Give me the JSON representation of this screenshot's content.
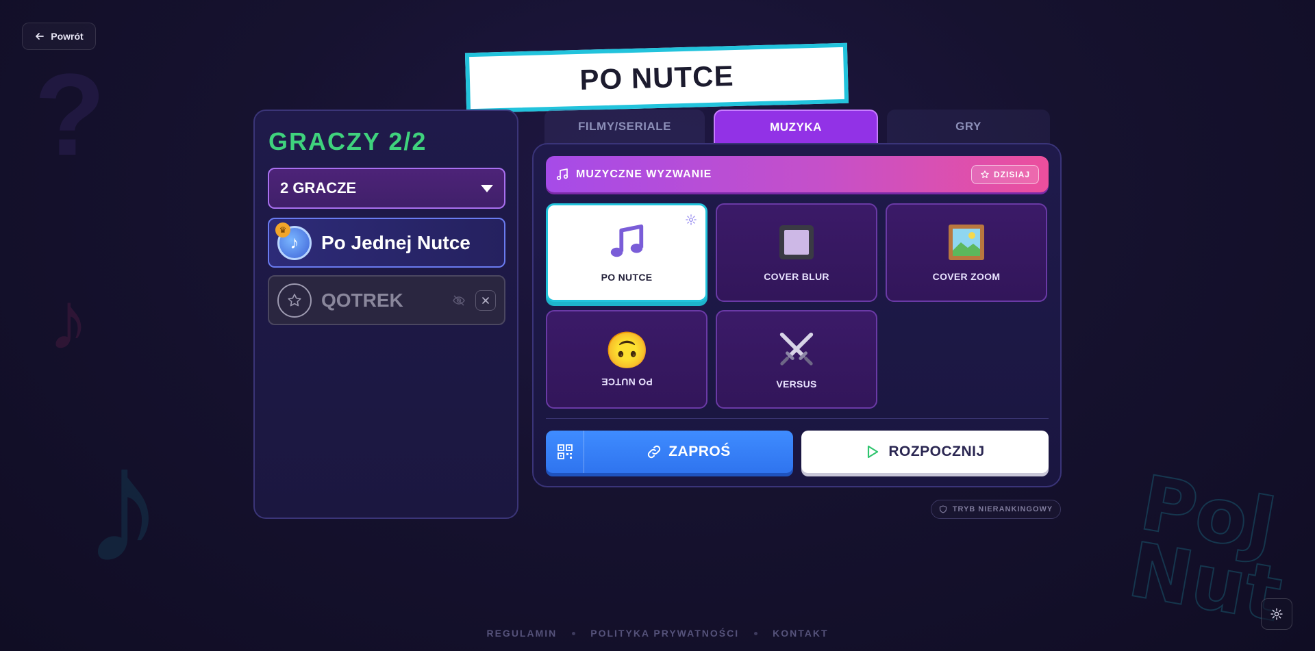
{
  "nav": {
    "back_label": "Powrót"
  },
  "header": {
    "title": "PO NUTCE"
  },
  "players": {
    "count_label": "GRACZY 2/2",
    "select_value": "2 GRACZE",
    "list": [
      {
        "name": "Po Jednej Nutce"
      },
      {
        "name": "QOTREK"
      }
    ]
  },
  "tabs": [
    {
      "label": "FILMY/SERIALE"
    },
    {
      "label": "MUZYKA"
    },
    {
      "label": "GRY"
    }
  ],
  "challenge": {
    "label": "MUZYCZNE WYZWANIE",
    "today_label": "DZISIAJ"
  },
  "modes": [
    {
      "label": "PO NUTCE",
      "icon": "music-note-icon"
    },
    {
      "label": "COVER BLUR",
      "icon": "blur-square-icon"
    },
    {
      "label": "COVER ZOOM",
      "icon": "framed-picture-icon"
    },
    {
      "label": "PO NUTCE",
      "icon": "upside-down-face-icon"
    },
    {
      "label": "VERSUS",
      "icon": "crossed-swords-icon"
    }
  ],
  "actions": {
    "invite_label": "ZAPROŚ",
    "start_label": "ROZPOCZNIJ"
  },
  "status": {
    "ranked_label": "TRYB NIERANKINGOWY"
  },
  "footer": {
    "links": [
      "REGULAMIN",
      "POLITYKA PRYWATNOŚCI",
      "KONTAKT"
    ]
  },
  "colors": {
    "accent_purple": "#9232e6",
    "accent_cyan": "#22c3dc",
    "players_green": "#3fd27d",
    "invite_blue": "#3f8cff"
  }
}
